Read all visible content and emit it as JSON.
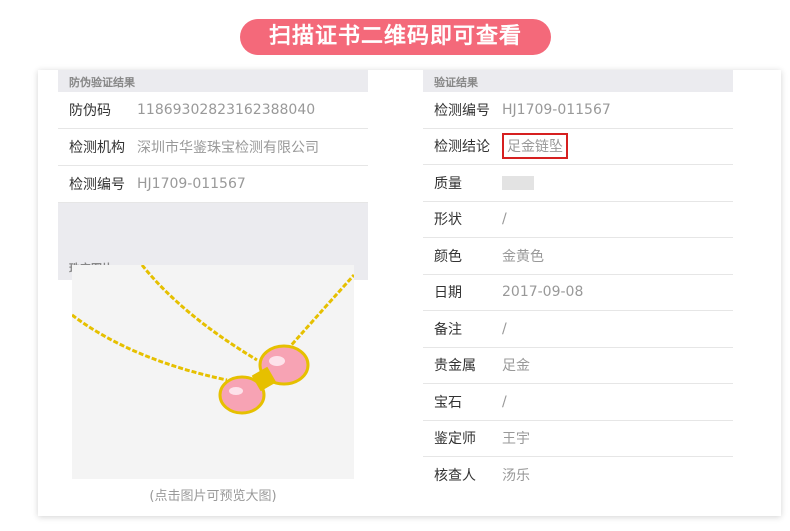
{
  "banner": {
    "text": "扫描证书二维码即可查看"
  },
  "left": {
    "section_title": "防伪验证结果",
    "rows": [
      {
        "label": "防伪码",
        "value": "11869302823162388040"
      },
      {
        "label": "检测机构",
        "value": "深圳市华鉴珠宝检测有限公司"
      },
      {
        "label": "检测编号",
        "value": "HJ1709-011567"
      }
    ],
    "photo_title": "珠宝图片",
    "photo_caption": "(点击图片可预览大图)"
  },
  "right": {
    "section_title": "验证结果",
    "rows": [
      {
        "label": "检测编号",
        "value": "HJ1709-011567"
      },
      {
        "label": "检测结论",
        "value": "足金链坠"
      },
      {
        "label": "质量",
        "value": ""
      },
      {
        "label": "形状",
        "value": "/"
      },
      {
        "label": "颜色",
        "value": "金黄色"
      },
      {
        "label": "日期",
        "value": "2017-09-08"
      },
      {
        "label": "备注",
        "value": "/"
      },
      {
        "label": "贵金属",
        "value": "足金"
      },
      {
        "label": "宝石",
        "value": "/"
      },
      {
        "label": "鉴定师",
        "value": "王宇"
      },
      {
        "label": "核查人",
        "value": "汤乐"
      }
    ]
  },
  "colors": {
    "banner": "#f4697a",
    "highlight_border": "#d62020"
  }
}
